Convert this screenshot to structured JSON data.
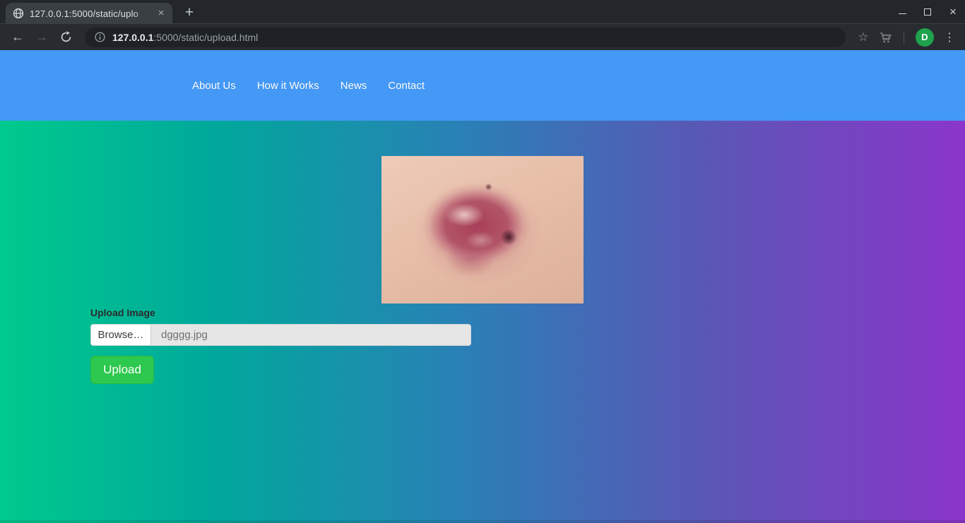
{
  "browser": {
    "tab_title": "127.0.0.1:5000/static/uplo",
    "tab_close": "×",
    "new_tab": "+",
    "window_close": "×",
    "url_host": "127.0.0.1",
    "url_rest": ":5000/static/upload.html",
    "avatar_letter": "D"
  },
  "nav": {
    "links": [
      {
        "label": "About Us"
      },
      {
        "label": "How it Works"
      },
      {
        "label": "News"
      },
      {
        "label": "Contact"
      }
    ]
  },
  "main": {
    "image_alt": "photograph of a reddish skin lesion on pale skin",
    "upload_label": "Upload Image",
    "browse_button": "Browse…",
    "filename": "dgggg.jpg",
    "upload_button": "Upload"
  },
  "colors": {
    "header_blue": "#4499f7",
    "gradient_left": "#00ca8d",
    "gradient_right": "#8b36ca",
    "upload_green": "#2dc84e",
    "avatar_green": "#1ea24c"
  }
}
